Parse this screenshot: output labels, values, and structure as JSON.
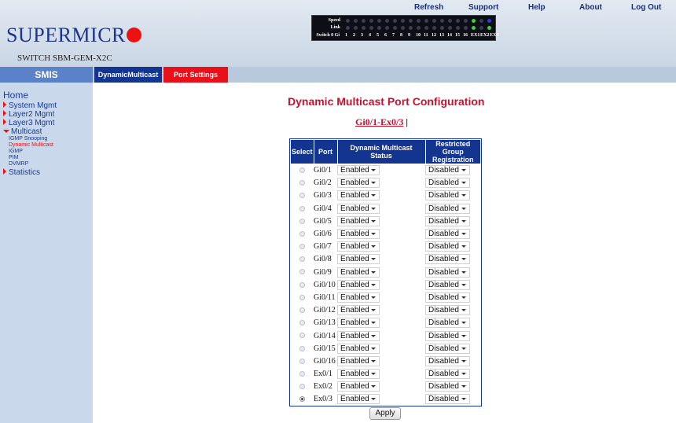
{
  "header": {
    "nav": {
      "refresh": "Refresh",
      "support": "Support",
      "help": "Help",
      "about": "About",
      "logout": "Log Out"
    },
    "brand": "SUPERMICR",
    "model": "SWITCH SBM-GEM-X2C",
    "led_panel": {
      "speed_label": "Speed",
      "link_label": "Link",
      "row_label": "Switch 0 Gi",
      "port_numbers": [
        "1",
        "2",
        "3",
        "4",
        "5",
        "6",
        "7",
        "8",
        "9",
        "10",
        "11",
        "12",
        "13",
        "14",
        "15",
        "16",
        "EX1",
        "EX2",
        "EX3"
      ],
      "speed_states": [
        "off",
        "off",
        "off",
        "off",
        "off",
        "off",
        "off",
        "off",
        "off",
        "off",
        "off",
        "off",
        "off",
        "off",
        "off",
        "off",
        "on",
        "off",
        "blue"
      ],
      "link_states": [
        "off",
        "off",
        "off",
        "off",
        "off",
        "off",
        "off",
        "off",
        "off",
        "off",
        "off",
        "off",
        "off",
        "off",
        "off",
        "off",
        "on",
        "off",
        "on"
      ]
    }
  },
  "menubar": {
    "smis": "SMIS",
    "tabs": [
      "DynamicMulticast",
      "Port Settings"
    ],
    "active_tab_color": "#e8111a"
  },
  "sidebar": {
    "home": "Home",
    "items": [
      "System Mgmt",
      "Layer2 Mgmt",
      "Layer3 Mgmt",
      "Multicast",
      "Statistics"
    ],
    "multicast_sub": [
      "IGMP Snooping",
      "Dynamic Multicast",
      "IGMP",
      "PIM",
      "DVMRP"
    ]
  },
  "main": {
    "title": "Dynamic Multicast Port Configuration",
    "range_link": "Gi0/1-Ex0/3",
    "range_sep": "|",
    "columns": [
      "Select",
      "Port",
      "Dynamic Multicast Status",
      "Restricted Group Registration"
    ],
    "rows": [
      {
        "port": "Gi0/1",
        "status": "Enabled",
        "rgr": "Disabled",
        "selected": false
      },
      {
        "port": "Gi0/2",
        "status": "Enabled",
        "rgr": "Disabled",
        "selected": false
      },
      {
        "port": "Gi0/3",
        "status": "Enabled",
        "rgr": "Disabled",
        "selected": false
      },
      {
        "port": "Gi0/4",
        "status": "Enabled",
        "rgr": "Disabled",
        "selected": false
      },
      {
        "port": "Gi0/5",
        "status": "Enabled",
        "rgr": "Disabled",
        "selected": false
      },
      {
        "port": "Gi0/6",
        "status": "Enabled",
        "rgr": "Disabled",
        "selected": false
      },
      {
        "port": "Gi0/7",
        "status": "Enabled",
        "rgr": "Disabled",
        "selected": false
      },
      {
        "port": "Gi0/8",
        "status": "Enabled",
        "rgr": "Disabled",
        "selected": false
      },
      {
        "port": "Gi0/9",
        "status": "Enabled",
        "rgr": "Disabled",
        "selected": false
      },
      {
        "port": "Gi0/10",
        "status": "Enabled",
        "rgr": "Disabled",
        "selected": false
      },
      {
        "port": "Gi0/11",
        "status": "Enabled",
        "rgr": "Disabled",
        "selected": false
      },
      {
        "port": "Gi0/12",
        "status": "Enabled",
        "rgr": "Disabled",
        "selected": false
      },
      {
        "port": "Gi0/13",
        "status": "Enabled",
        "rgr": "Disabled",
        "selected": false
      },
      {
        "port": "Gi0/14",
        "status": "Enabled",
        "rgr": "Disabled",
        "selected": false
      },
      {
        "port": "Gi0/15",
        "status": "Enabled",
        "rgr": "Disabled",
        "selected": false
      },
      {
        "port": "Gi0/16",
        "status": "Enabled",
        "rgr": "Disabled",
        "selected": false
      },
      {
        "port": "Ex0/1",
        "status": "Enabled",
        "rgr": "Disabled",
        "selected": false
      },
      {
        "port": "Ex0/2",
        "status": "Enabled",
        "rgr": "Disabled",
        "selected": false
      },
      {
        "port": "Ex0/3",
        "status": "Enabled",
        "rgr": "Disabled",
        "selected": true
      }
    ],
    "apply": "Apply"
  },
  "colors": {
    "brand_blue": "#1d3590",
    "accent_red": "#c8102e",
    "table_header": "#13348f"
  }
}
